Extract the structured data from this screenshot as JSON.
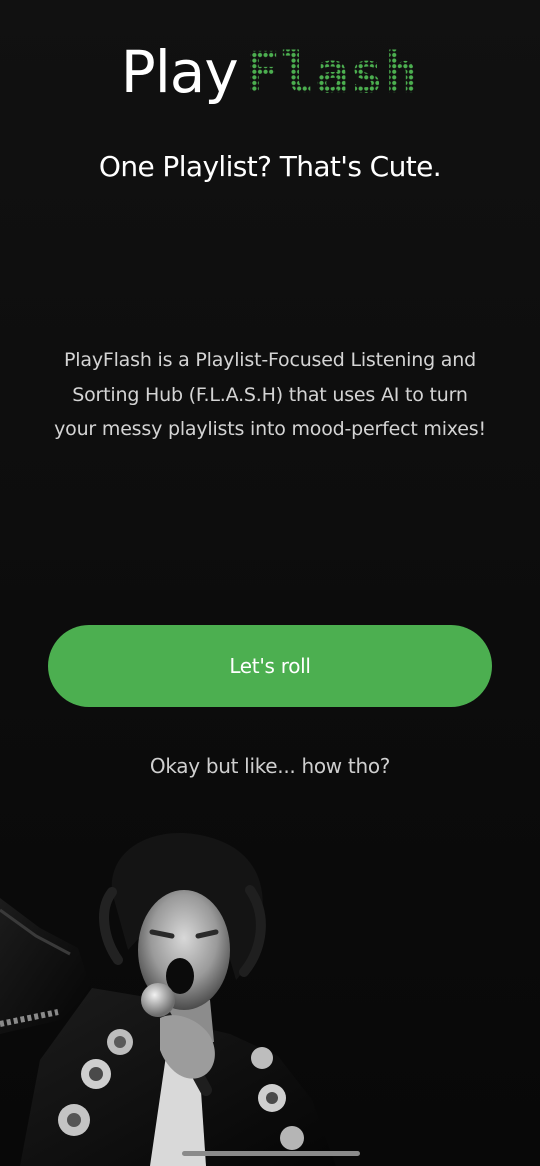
{
  "logo": {
    "play": "Play",
    "flash": "Flash",
    "accent_color": "#4caf50"
  },
  "tagline": "One Playlist? That's Cute.",
  "description": "PlayFlash is a Playlist-Focused Listening and Sorting Hub (F.L.A.S.H) that uses AI to turn your messy playlists into mood-perfect mixes!",
  "cta_label": "Let's roll",
  "secondary_link": "Okay but like... how tho?",
  "hero_image": {
    "icon": "performer-with-microphone-photo"
  }
}
